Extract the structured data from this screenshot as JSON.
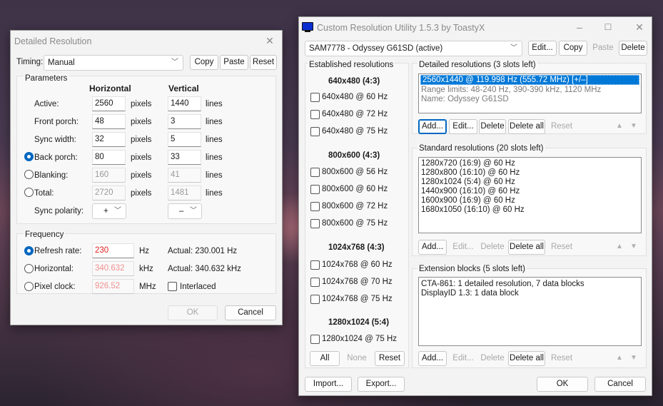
{
  "detailed": {
    "title": "Detailed Resolution",
    "timing_label": "Timing:",
    "timing_value": "Manual",
    "copy": "Copy",
    "paste": "Paste",
    "reset": "Reset",
    "parameters_label": "Parameters",
    "horizontal_header": "Horizontal",
    "vertical_header": "Vertical",
    "rows": [
      {
        "label": "Active:",
        "h": "2560",
        "h_unit": "pixels",
        "v": "1440",
        "v_unit": "lines"
      },
      {
        "label": "Front porch:",
        "h": "48",
        "h_unit": "pixels",
        "v": "3",
        "v_unit": "lines"
      },
      {
        "label": "Sync width:",
        "h": "32",
        "h_unit": "pixels",
        "v": "5",
        "v_unit": "lines"
      },
      {
        "label": "Back porch:",
        "h": "80",
        "h_unit": "pixels",
        "v": "33",
        "v_unit": "lines"
      },
      {
        "label": "Blanking:",
        "h": "160",
        "h_unit": "pixels",
        "v": "41",
        "v_unit": "lines"
      },
      {
        "label": "Total:",
        "h": "2720",
        "h_unit": "pixels",
        "v": "1481",
        "v_unit": "lines"
      }
    ],
    "sync_polarity_label": "Sync polarity:",
    "sync_h": "+",
    "sync_v": "–",
    "frequency_label": "Frequency",
    "refresh_label": "Refresh rate:",
    "refresh_value": "230",
    "refresh_unit": "Hz",
    "refresh_actual": "Actual: 230.001 Hz",
    "horizontal_label": "Horizontal:",
    "horizontal_value": "340.632",
    "horizontal_unit": "kHz",
    "horizontal_actual": "Actual: 340.632 kHz",
    "pixel_clock_label": "Pixel clock:",
    "pixel_clock_value": "926.52",
    "pixel_clock_unit": "MHz",
    "interlaced_label": "Interlaced",
    "ok": "OK",
    "cancel": "Cancel"
  },
  "cru": {
    "title": "Custom Resolution Utility 1.5.3 by ToastyX",
    "monitor": "SAM7778 - Odyssey G61SD (active)",
    "edit": "Edit...",
    "copy": "Copy",
    "paste": "Paste",
    "delete": "Delete",
    "established_label": "Established resolutions",
    "est_groups": [
      {
        "header": "640x480 (4:3)",
        "items": [
          "640x480 @ 60 Hz",
          "640x480 @ 72 Hz",
          "640x480 @ 75 Hz"
        ]
      },
      {
        "header": "800x600 (4:3)",
        "items": [
          "800x600 @ 56 Hz",
          "800x600 @ 60 Hz",
          "800x600 @ 72 Hz",
          "800x600 @ 75 Hz"
        ]
      },
      {
        "header": "1024x768 (4:3)",
        "items": [
          "1024x768 @ 60 Hz",
          "1024x768 @ 70 Hz",
          "1024x768 @ 75 Hz"
        ]
      },
      {
        "header": "1280x1024 (5:4)",
        "items": [
          "1280x1024 @ 75 Hz"
        ]
      }
    ],
    "all": "All",
    "none": "None",
    "reset": "Reset",
    "detailed_label": "Detailed resolutions (3 slots left)",
    "detailed_items": [
      "2560x1440 @ 119.998 Hz (555.72 MHz) [+/–]",
      "Range limits: 48-240 Hz, 390-390 kHz, 1120 MHz",
      "Name: Odyssey G61SD"
    ],
    "add": "Add...",
    "delete_all": "Delete all",
    "standard_label": "Standard resolutions (20 slots left)",
    "standard_items": [
      "1280x720 (16:9) @ 60 Hz",
      "1280x800 (16:10) @ 60 Hz",
      "1280x1024 (5:4) @ 60 Hz",
      "1440x900 (16:10) @ 60 Hz",
      "1600x900 (16:9) @ 60 Hz",
      "1680x1050 (16:10) @ 60 Hz"
    ],
    "extension_label": "Extension blocks (5 slots left)",
    "extension_items": [
      "CTA-861: 1 detailed resolution, 7 data blocks",
      "DisplayID 1.3: 1 data block"
    ],
    "import": "Import...",
    "export": "Export...",
    "ok": "OK",
    "cancel": "Cancel"
  }
}
